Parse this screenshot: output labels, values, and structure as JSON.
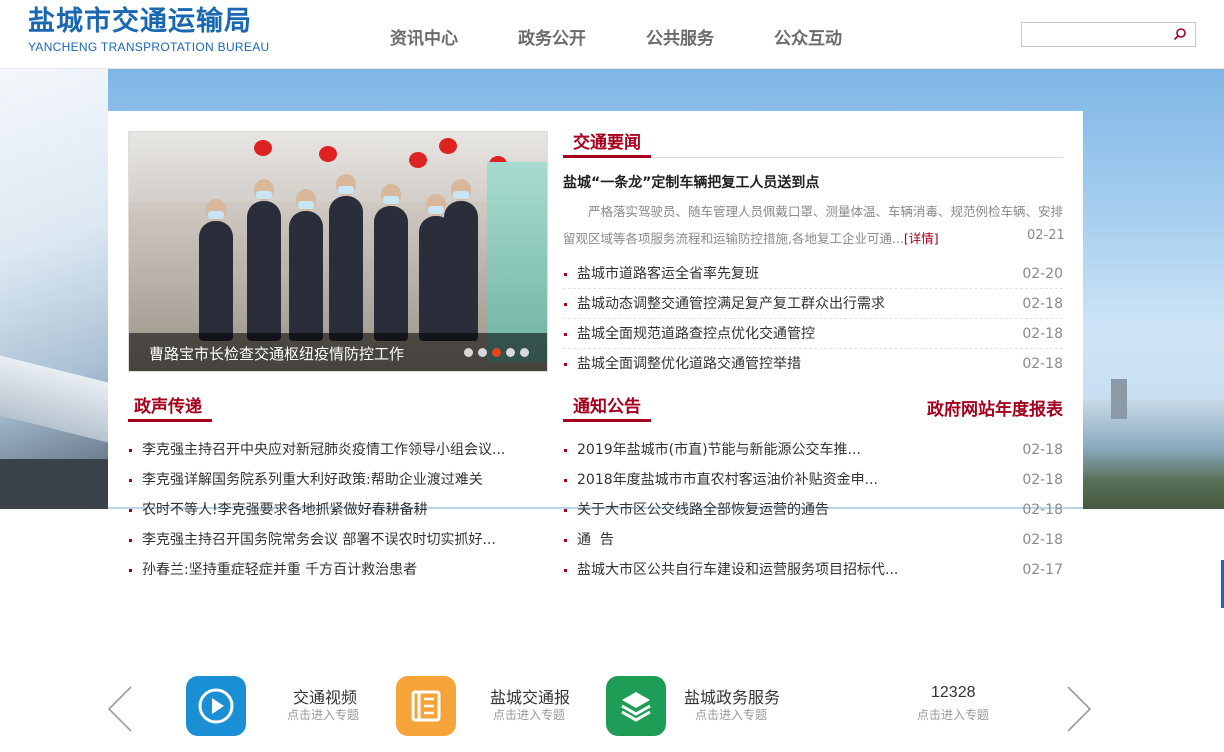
{
  "header": {
    "logo_cn": "盐城市交通运输局",
    "logo_en": "YANCHENG TRANSPROTATION BUREAU",
    "nav": [
      "资讯中心",
      "政务公开",
      "公共服务",
      "公众互动"
    ],
    "search_placeholder": ""
  },
  "carousel": {
    "caption": "曹路宝市长检查交通枢纽疫情防控工作",
    "dots": 5,
    "active_dot": 3
  },
  "traffic_news": {
    "title": "交通要闻",
    "headline": "盐城“一条龙”定制车辆把复工人员送到点",
    "summary": "严格落实驾驶员、随车管理人员佩戴口罩、测量体温、车辆消毒、规范例检车辆、安排留观区域等各项服务流程和运输防控措施,各地复工企业可通...",
    "summary_more": "[详情]",
    "summary_date": "02-21",
    "items": [
      {
        "text": "盐城市道路客运全省率先复班",
        "date": "02-20"
      },
      {
        "text": "盐城动态调整交通管控满足复产复工群众出行需求",
        "date": "02-18"
      },
      {
        "text": "盐城全面规范道路查控点优化交通管控",
        "date": "02-18"
      },
      {
        "text": "盐城全面调整优化道路交通管控举措",
        "date": "02-18"
      }
    ]
  },
  "gov_voice": {
    "title": "政声传递",
    "items": [
      {
        "text": "李克强主持召开中央应对新冠肺炎疫情工作领导小组会议..."
      },
      {
        "text": "李克强详解国务院系列重大利好政策:帮助企业渡过难关"
      },
      {
        "text": "农时不等人!李克强要求各地抓紧做好春耕备耕"
      },
      {
        "text": "李克强主持召开国务院常务会议 部署不误农时切实抓好..."
      },
      {
        "text": "孙春兰:坚持重症轻症并重 千方百计救治患者"
      }
    ]
  },
  "notices": {
    "title": "通知公告",
    "extra": "政府网站年度报表",
    "items": [
      {
        "text": "2019年盐城市(市直)节能与新能源公交车推...",
        "date": "02-18"
      },
      {
        "text": "2018年度盐城市市直农村客运油价补贴资金申...",
        "date": "02-18"
      },
      {
        "text": "关于大市区公交线路全部恢复运营的通告",
        "date": "02-18"
      },
      {
        "text": "通  告",
        "date": "02-18"
      },
      {
        "text": "盐城大市区公共自行车建设和运营服务项目招标代...",
        "date": "02-17"
      }
    ]
  },
  "services": [
    {
      "title": "交通视频",
      "sub": "点击进入专题",
      "icon": "play-icon",
      "color": "#1a8fd6"
    },
    {
      "title": "盐城交通报",
      "sub": "点击进入专题",
      "icon": "newspaper-icon",
      "color": "#f6a43a"
    },
    {
      "title": "盐城政务服务",
      "sub": "点击进入专题",
      "icon": "layers-icon",
      "color": "#1f9d57"
    },
    {
      "title": "12328",
      "sub": "点击进入专题",
      "icon": "hotline-icon",
      "color": "#ffffff"
    }
  ]
}
